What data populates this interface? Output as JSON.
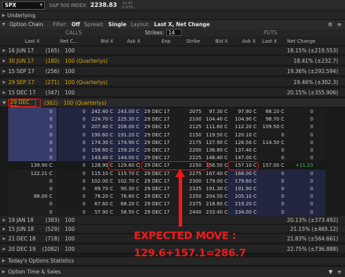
{
  "topbar": {
    "symbol": "SPX",
    "index_name": "S&P 500 INDEX",
    "last_price": "2238.83",
    "mini_line1": "-10.43",
    "mini_line2": "-0.47%"
  },
  "sections": {
    "underlying": "Underlying",
    "option_chain": "Option Chain",
    "today_stats": "Today's Options Statistics",
    "time_sales": "Option Time & Sales"
  },
  "filters": {
    "filter_label": "Filter:",
    "filter_value": "Off",
    "spread_label": "Spread:",
    "spread_value": "Single",
    "layout_label": "Layout:",
    "layout_value": "Last X, Net Change"
  },
  "header": {
    "calls": "CALLS",
    "puts": "PUTS",
    "strikes_label": "Strikes:",
    "strikes_value": "14"
  },
  "columns": {
    "last_x_c": "Last X",
    "net_c": "Net C...",
    "bid_x_c": "Bid X",
    "ask_x_c": "Ask X",
    "exp": "Exp",
    "strike": "Strike",
    "bid_x_p": "Bid X",
    "ask_x_p": "Ask X",
    "last_x_p": "Last X",
    "net_c_p": "Net Change"
  },
  "expirations_top": [
    {
      "date": "16 JUN 17",
      "days": "(165)",
      "desc": "100",
      "iv": "18.15% (±219.553)",
      "quarterly": false
    },
    {
      "date": "30 JUN 17",
      "days": "(180)",
      "desc": "100 (Quarterlys)",
      "iv": "18.41% (±232.7)",
      "quarterly": true
    },
    {
      "date": "15 SEP 17",
      "days": "(256)",
      "desc": "100",
      "iv": "19.36% (±292.594)",
      "quarterly": false
    },
    {
      "date": "29 SEP 17",
      "days": "(271)",
      "desc": "100 (Quarterlys)",
      "iv": "19.46% (±302.3)",
      "quarterly": true
    },
    {
      "date": "15 DEC 17",
      "days": "(347)",
      "desc": "100",
      "iv": "20.15% (±355.906)",
      "quarterly": false
    }
  ],
  "open_expiration": {
    "date": "29 DEC 17",
    "days": "(362)",
    "desc": "100 (Quarterlys)"
  },
  "chain_rows": [
    {
      "c_last": "0",
      "c_net": "0",
      "c_bid": "242.40 C",
      "c_ask": "243.00 C",
      "exp": "29 DEC 17",
      "strike": "2075",
      "p_bid": "97.30 C",
      "p_ask": "97.90 C",
      "p_last": "88.10 C",
      "p_net": "0"
    },
    {
      "c_last": "0",
      "c_net": "0",
      "c_bid": "224.70 C",
      "c_ask": "225.30 C",
      "exp": "29 DEC 17",
      "strike": "2100",
      "p_bid": "104.40 C",
      "p_ask": "104.90 C",
      "p_last": "98.70 C",
      "p_net": "0"
    },
    {
      "c_last": "0",
      "c_net": "0",
      "c_bid": "207.40 C",
      "c_ask": "208.00 C",
      "exp": "29 DEC 17",
      "strike": "2125",
      "p_bid": "111.60 C",
      "p_ask": "112.20 C",
      "p_last": "109.50 C",
      "p_net": "0"
    },
    {
      "c_last": "0",
      "c_net": "0",
      "c_bid": "190.60 C",
      "c_ask": "191.20 C",
      "exp": "29 DEC 17",
      "strike": "2150",
      "p_bid": "119.50 C",
      "p_ask": "120.10 C",
      "p_last": "0",
      "p_net": "0"
    },
    {
      "c_last": "0",
      "c_net": "0",
      "c_bid": "174.30 C",
      "c_ask": "174.90 C",
      "exp": "29 DEC 17",
      "strike": "2175",
      "p_bid": "127.90 C",
      "p_ask": "128.50 C",
      "p_last": "114.50 C",
      "p_net": "0"
    },
    {
      "c_last": "0",
      "c_net": "0",
      "c_bid": "158.60 C",
      "c_ask": "159.20 C",
      "exp": "29 DEC 17",
      "strike": "2200",
      "p_bid": "136.80 C",
      "p_ask": "137.40 C",
      "p_last": "0",
      "p_net": "0"
    },
    {
      "c_last": "0",
      "c_net": "0",
      "c_bid": "143.40 C",
      "c_ask": "144.00 C",
      "exp": "29 DEC 17",
      "strike": "2225",
      "p_bid": "146.40 C",
      "p_ask": "147.00 C",
      "p_last": "0",
      "p_net": "0"
    },
    {
      "c_last": "139.90 C",
      "c_net": "0",
      "c_bid": "128.90 C",
      "c_ask": "129.60 C",
      "exp": "29 DEC 17",
      "strike": "2250",
      "p_bid": "156.50 C",
      "p_ask": "157.10 C",
      "p_last": "157.00 C",
      "p_net": "+11.23"
    },
    {
      "c_last": "122.21 C",
      "c_net": "0",
      "c_bid": "115.10 C",
      "c_ask": "115.70 C",
      "exp": "29 DEC 17",
      "strike": "2275",
      "p_bid": "167.40 C",
      "p_ask": "168.00 C",
      "p_last": "0",
      "p_net": "0"
    },
    {
      "c_last": "0",
      "c_net": "0",
      "c_bid": "102.00 C",
      "c_ask": "102.70 C",
      "exp": "29 DEC 17",
      "strike": "2300",
      "p_bid": "179.00 C",
      "p_ask": "179.60 C",
      "p_last": "0",
      "p_net": "0"
    },
    {
      "c_last": "0",
      "c_net": "0",
      "c_bid": "89.70 C",
      "c_ask": "90.30 C",
      "exp": "29 DEC 17",
      "strike": "2325",
      "p_bid": "191.30 C",
      "p_ask": "191.90 C",
      "p_last": "0",
      "p_net": "0"
    },
    {
      "c_last": "88.00 C",
      "c_net": "0",
      "c_bid": "78.20 C",
      "c_ask": "78.80 C",
      "exp": "29 DEC 17",
      "strike": "2350",
      "p_bid": "204.50 C",
      "p_ask": "205.10 C",
      "p_last": "0",
      "p_net": "0"
    },
    {
      "c_last": "0",
      "c_net": "0",
      "c_bid": "67.60 C",
      "c_ask": "68.20 C",
      "exp": "29 DEC 17",
      "strike": "2375",
      "p_bid": "218.60 C",
      "p_ask": "219.20 C",
      "p_last": "0",
      "p_net": "0"
    },
    {
      "c_last": "0",
      "c_net": "0",
      "c_bid": "57.90 C",
      "c_ask": "58.50 C",
      "exp": "29 DEC 17",
      "strike": "2400",
      "p_bid": "233.40 C",
      "p_ask": "234.00 C",
      "p_last": "0",
      "p_net": "0"
    }
  ],
  "expirations_bottom": [
    {
      "date": "19 JAN 18",
      "days": "(383)",
      "desc": "100",
      "iv": "20.13% (±373.492)",
      "quarterly": false
    },
    {
      "date": "15 JUN 18",
      "days": "(529)",
      "desc": "100",
      "iv": "21.15% (±465.12)",
      "quarterly": false
    },
    {
      "date": "21 DEC 18",
      "days": "(718)",
      "desc": "100",
      "iv": "21.83% (±564.661)",
      "quarterly": false
    },
    {
      "date": "20 DEC 19",
      "days": "(1082)",
      "desc": "100",
      "iv": "22.75% (±736.888)",
      "quarterly": false
    }
  ],
  "annotation": {
    "line1": "EXPECTED MOVE :",
    "line2": "129.6+157.1=286.7"
  },
  "colors": {
    "annotation": "#ee1a1a",
    "quarterly": "#d8a800",
    "itm_call": "#373c6b",
    "net_positive": "#2ecc40"
  }
}
